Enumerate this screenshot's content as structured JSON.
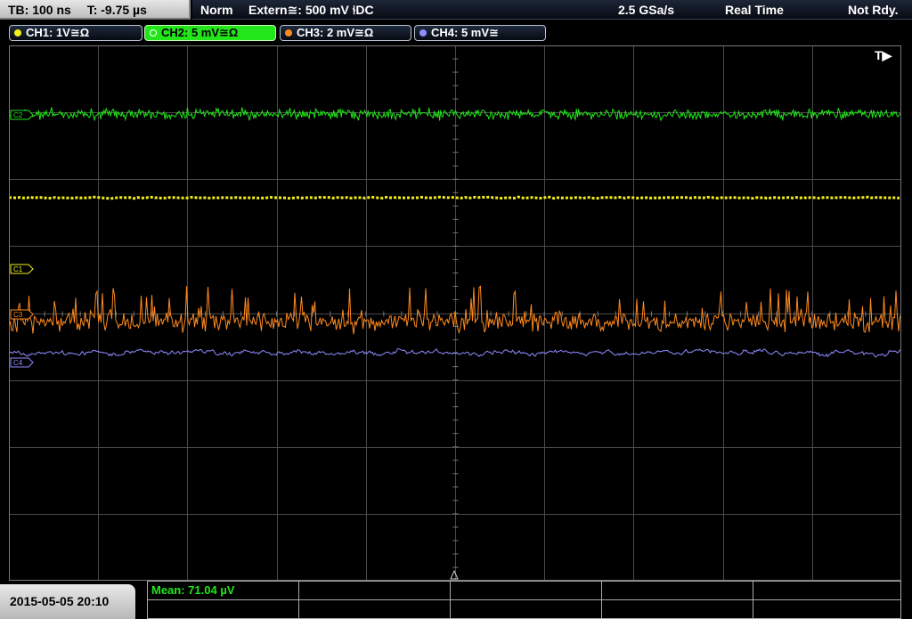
{
  "status_bar": {
    "timebase": "TB: 100 ns",
    "trigger_time": "T: -9.75 µs",
    "mode": "Norm",
    "trigger_source": "Extern≅: 500 mV ⫮DC",
    "sample_rate": "2.5 GSa/s",
    "acq_mode": "Real Time",
    "state": "Not Rdy."
  },
  "channels": [
    {
      "label": "CH1: 1V≅Ω",
      "color": "#f2ef1a",
      "active": false
    },
    {
      "label": "CH2: 5 mV≅Ω",
      "color": "#22e61a",
      "active": true
    },
    {
      "label": "CH3: 2 mV≅Ω",
      "color": "#ff8a1e",
      "active": false
    },
    {
      "label": "CH4: 5 mV≅",
      "color": "#8f8cff",
      "active": false
    }
  ],
  "markers": {
    "c1": "C1",
    "c2": "C2",
    "c3": "C3",
    "c4": "C4",
    "trigger": "T▶"
  },
  "measurement": {
    "mean": "Mean: 71.04 µV"
  },
  "datetime": "2015-05-05 20:10",
  "colors": {
    "ch1": "#f2ef1a",
    "ch2": "#22e61a",
    "ch3": "#ff8a1e",
    "ch4": "#8f8cff",
    "grid": "#555555",
    "measurement_text": "#22e61a"
  }
}
